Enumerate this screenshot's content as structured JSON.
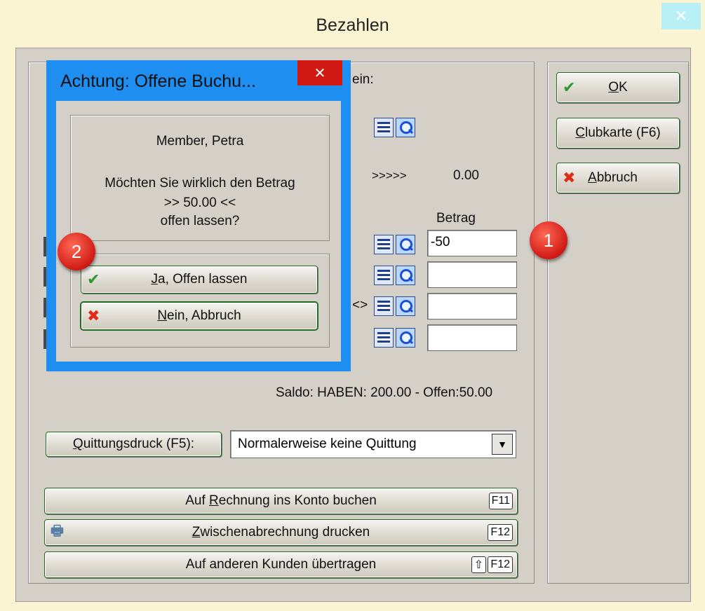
{
  "window": {
    "title": "Bezahlen",
    "close_glyph": "✕"
  },
  "main": {
    "enter_label_suffix": "ein:",
    "arrows": ">>>>>",
    "arrow_value": "0.00",
    "betrag_header": "Betrag",
    "amount_rows": [
      {
        "value": "-50"
      },
      {
        "value": ""
      },
      {
        "value": ""
      },
      {
        "value": ""
      }
    ],
    "row3_prefix": "<>",
    "saldo_text": "Saldo: HABEN: 200.00 - Offen:50.00",
    "receipt_button": {
      "prefix": "Q",
      "rest": "uittungsdruck (F5):"
    },
    "receipt_select": {
      "value": "Normalerweise keine Quittung"
    },
    "actions": [
      {
        "pre": "Auf ",
        "u": "R",
        "post": "echnung ins Konto buchen",
        "key": "F11"
      },
      {
        "pre": "",
        "u": "Z",
        "post": "wischenabrechnung drucken",
        "key": "F12"
      },
      {
        "pre": "Auf anderen Kunden übertragen",
        "u": "",
        "post": "",
        "key": "F12",
        "shift": "⇧"
      }
    ]
  },
  "side": {
    "ok": {
      "u": "O",
      "post": "K"
    },
    "clubkarte": {
      "u": "C",
      "post": "lubkarte (F6)"
    },
    "abbruch": {
      "u": "A",
      "post": "bbruch"
    }
  },
  "badges": {
    "one": "1",
    "two": "2"
  },
  "dialog": {
    "title": "Achtung: Offene Buchu...",
    "close_glyph": "✕",
    "member": "Member, Petra",
    "question": "Möchten Sie wirklich den Betrag",
    "amount_line": ">> 50.00 <<",
    "leave_open": "offen lassen?",
    "yes": {
      "u": "J",
      "post": "a, Offen lassen"
    },
    "no": {
      "u": "N",
      "post": "ein, Abbruch"
    }
  },
  "colors": {
    "accent_blue": "#1e8ef0",
    "close_red": "#d11a14",
    "ok_green": "#2e9a2e",
    "cancel_red": "#e02a1a"
  }
}
